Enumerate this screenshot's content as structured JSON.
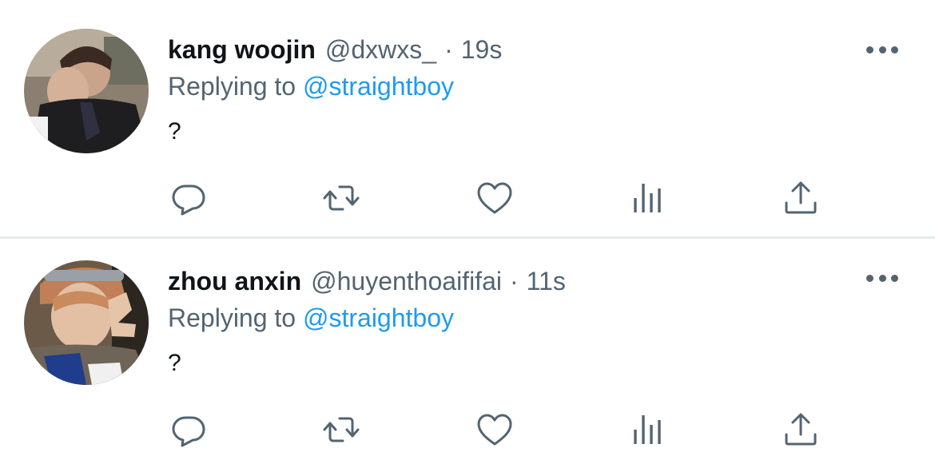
{
  "tweets": [
    {
      "name": "kang woojin",
      "handle": "@dxwxs_",
      "separator": "·",
      "time": "19s",
      "replying_prefix": "Replying to",
      "replying_to": "@straightboy",
      "text": "?"
    },
    {
      "name": "zhou anxin",
      "handle": "@huyenthoaififai",
      "separator": "·",
      "time": "11s",
      "replying_prefix": "Replying to",
      "replying_to": "@straightboy",
      "text": "?"
    }
  ],
  "icons": [
    "more-icon",
    "reply-icon",
    "retweet-icon",
    "like-icon",
    "views-icon",
    "share-icon"
  ],
  "colors": {
    "text_primary": "#0f1419",
    "text_secondary": "#536471",
    "link": "#1d9bf0",
    "divider": "#e7e9ea"
  }
}
